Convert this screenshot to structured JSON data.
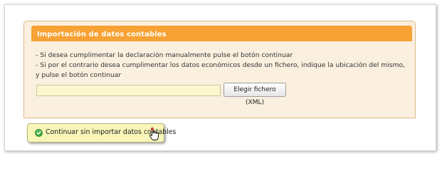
{
  "panel": {
    "title": "Importación de datos contables",
    "instructions": [
      "- Si desea cumplimentar la declaración manualmente pulse el botón continuar",
      "- Si por el contrario desea cumplimentar los datos económicos desde un fichero, indique la ubicación del mismo, y pulse el botón continuar"
    ],
    "file_input_value": "",
    "file_button_label": "Elegir fichero (XML)"
  },
  "continue_button": {
    "label": "Continuar sin importar datos contables",
    "icon": "check-icon"
  },
  "colors": {
    "header_orange": "#f7a234",
    "panel_background": "#fbf0df",
    "file_field_background": "#fdf7cf",
    "continue_button_background": "#f8f6b8",
    "check_green": "#3aa53a"
  }
}
